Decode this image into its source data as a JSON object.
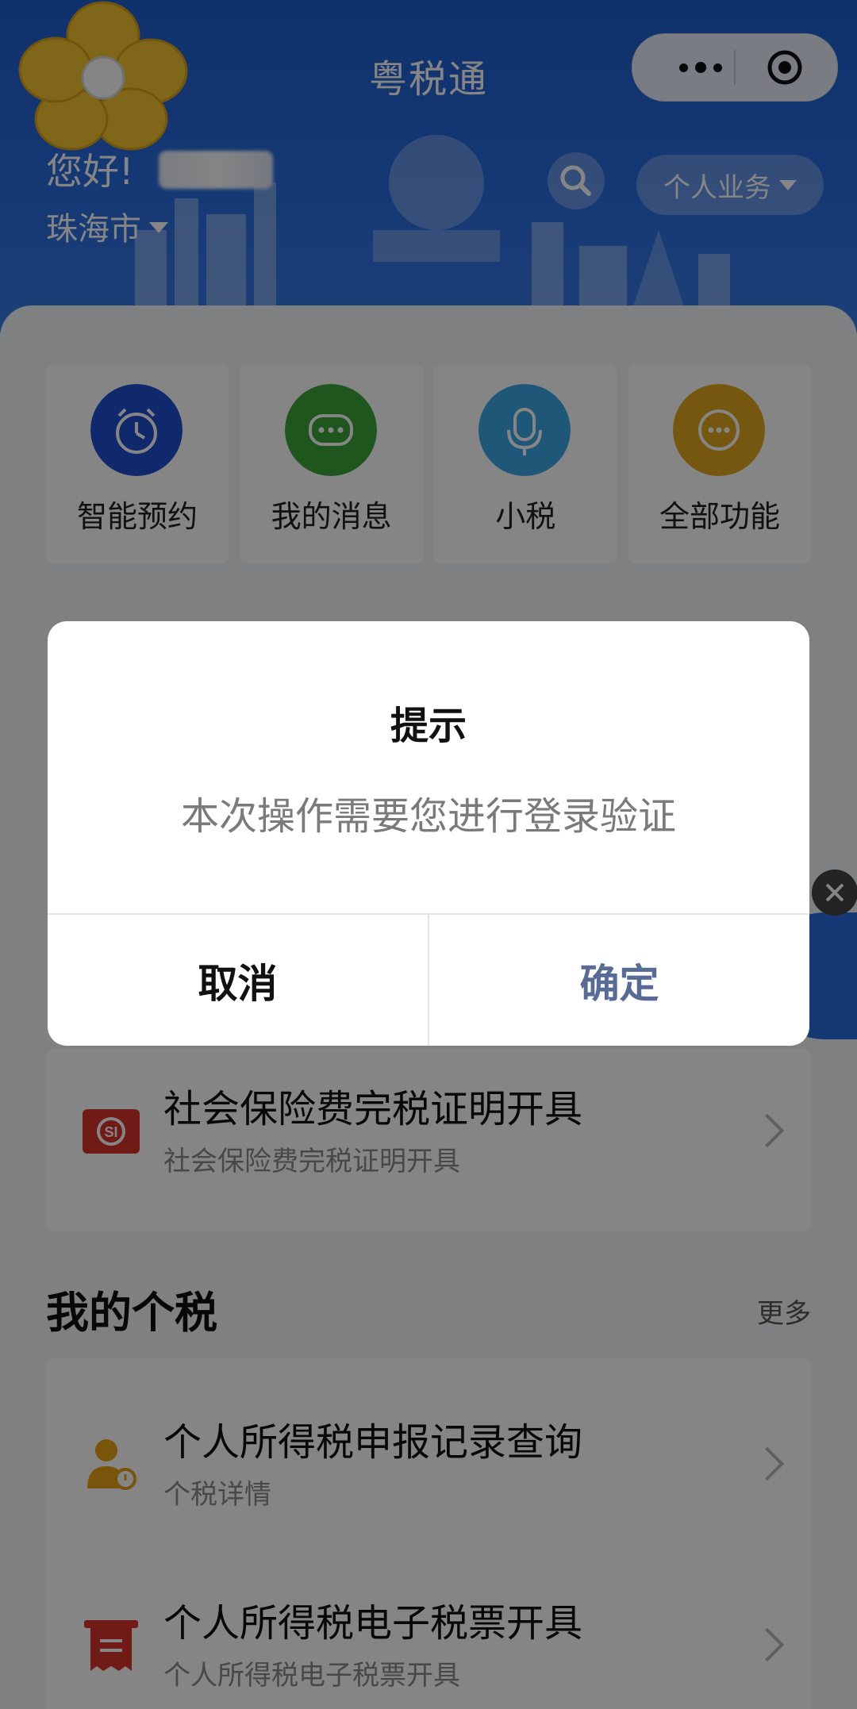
{
  "header": {
    "app_title": "粤税通",
    "greeting": "您好!",
    "city": "珠海市",
    "business_selector": "个人业务"
  },
  "quick_actions": [
    {
      "label": "智能预约",
      "icon": "alarm-clock-icon",
      "color": "#1f4fd1"
    },
    {
      "label": "我的消息",
      "icon": "chat-bubble-icon",
      "color": "#3aa63a"
    },
    {
      "label": "小税",
      "icon": "microphone-icon",
      "color": "#3ba8e6"
    },
    {
      "label": "全部功能",
      "icon": "more-dots-icon",
      "color": "#e0a81f"
    }
  ],
  "services": [
    {
      "title": "社会保险费完税证明开具",
      "subtitle": "社会保险费完税证明开具",
      "icon": "social-insurance-icon"
    }
  ],
  "personal_tax": {
    "section_title": "我的个税",
    "more_label": "更多",
    "items": [
      {
        "title": "个人所得税申报记录查询",
        "subtitle": "个税详情",
        "icon": "person-search-icon"
      },
      {
        "title": "个人所得税电子税票开具",
        "subtitle": "个人所得税电子税票开具",
        "icon": "tax-ticket-icon"
      }
    ]
  },
  "dialog": {
    "title": "提示",
    "message": "本次操作需要您进行登录验证",
    "cancel_label": "取消",
    "confirm_label": "确定"
  },
  "colors": {
    "header_blue": "#2a6ee0",
    "confirm_text": "#576b95"
  }
}
